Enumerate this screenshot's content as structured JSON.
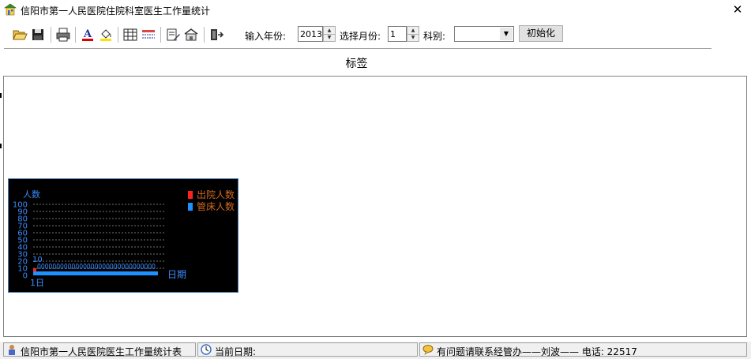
{
  "window": {
    "title": "信阳市第一人民医院住院科室医生工作量统计",
    "close": "✕"
  },
  "toolbar": {
    "year_label": "输入年份:",
    "year_value": "2013",
    "month_label": "选择月份:",
    "month_value": "1",
    "dept_label": "科别:",
    "dept_value": "",
    "init_button": "初始化"
  },
  "tab_label": "标签",
  "chart_data": {
    "type": "bar",
    "ylabel": "人数",
    "xlabel": "日期",
    "ylim": [
      0,
      100
    ],
    "yticks": [
      "100",
      "90",
      "80",
      "70",
      "60",
      "50",
      "40",
      "30",
      "20",
      "10",
      "0"
    ],
    "categories": [
      "1日"
    ],
    "series": [
      {
        "name": "出院人数",
        "color": "#ff2020",
        "values": [
          10
        ]
      },
      {
        "name": "管床人数",
        "color": "#1e90ff",
        "values": [
          0
        ]
      }
    ],
    "data_labels": [
      "10",
      "0000000000000000000000000000000"
    ],
    "background": "#000000",
    "legend_text_color": "#d2691e",
    "axis_text_color": "#3c8cff",
    "grid": true
  },
  "statusbar": {
    "program_name": "信阳市第一人民医院医生工作量统计表",
    "current_date_label": "当前日期:",
    "contact": "有问题请联系经管办——刘波——  电话: 22517"
  }
}
